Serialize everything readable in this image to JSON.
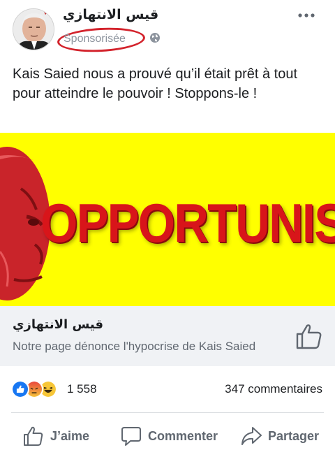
{
  "post": {
    "page_name": "قيس الانتهازي",
    "sponsored_label": "Sponsorisée",
    "visibility_icon": "globe-icon",
    "more_icon": "more-options-icon",
    "text": "Kais Saied nous a prouvé qu’il était prêt à tout pour atteindre le pouvoir ! Stoppons-le !"
  },
  "banner": {
    "headline": "OPPORTUNIS",
    "background_color": "#ffff00",
    "text_color": "#d8151a"
  },
  "link": {
    "title": "قيس الانتهازي",
    "description": "Notre page dénonce l'hypocrise de Kais Saied",
    "like_icon": "thumbs-up-icon"
  },
  "stats": {
    "reactions": [
      "like",
      "angry",
      "haha"
    ],
    "reaction_count": "1 558",
    "comments": "347 commentaires"
  },
  "actions": {
    "like_label": "J’aime",
    "comment_label": "Commenter",
    "share_label": "Partager"
  },
  "colors": {
    "highlight_ring": "#d3232c",
    "secondary_text": "#606770",
    "link_bg": "#f0f2f5"
  }
}
